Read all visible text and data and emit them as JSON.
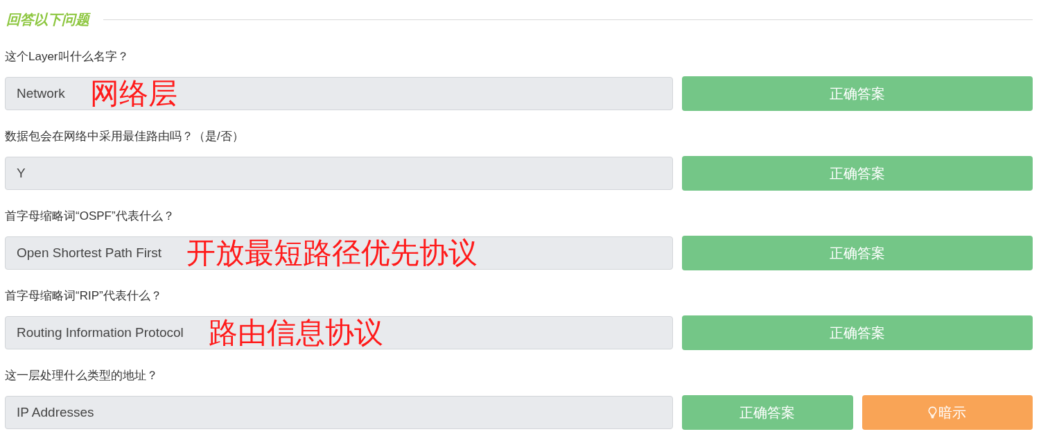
{
  "heading": "回答以下问题",
  "questions": [
    {
      "question": "这个Layer叫什么名字？",
      "answer": "Network",
      "annotation": "网络层",
      "buttons": [
        {
          "kind": "answer",
          "label": "正确答案"
        }
      ]
    },
    {
      "question": "数据包会在网络中采用最佳路由吗？（是/否）",
      "answer": "Y",
      "buttons": [
        {
          "kind": "answer",
          "label": "正确答案"
        }
      ]
    },
    {
      "question": "首字母缩略词“OSPF”代表什么？",
      "answer": "Open Shortest Path First",
      "annotation": "开放最短路径优先协议",
      "buttons": [
        {
          "kind": "answer",
          "label": "正确答案"
        }
      ]
    },
    {
      "question": "首字母缩略词“RIP”代表什么？",
      "answer": "Routing Information Protocol",
      "annotation": "路由信息协议",
      "buttons": [
        {
          "kind": "answer",
          "label": "正确答案"
        }
      ]
    },
    {
      "question": "这一层处理什么类型的地址？",
      "answer": "IP Addresses",
      "buttons": [
        {
          "kind": "answer",
          "label": "正确答案"
        },
        {
          "kind": "hint",
          "label": "暗示"
        }
      ]
    }
  ]
}
